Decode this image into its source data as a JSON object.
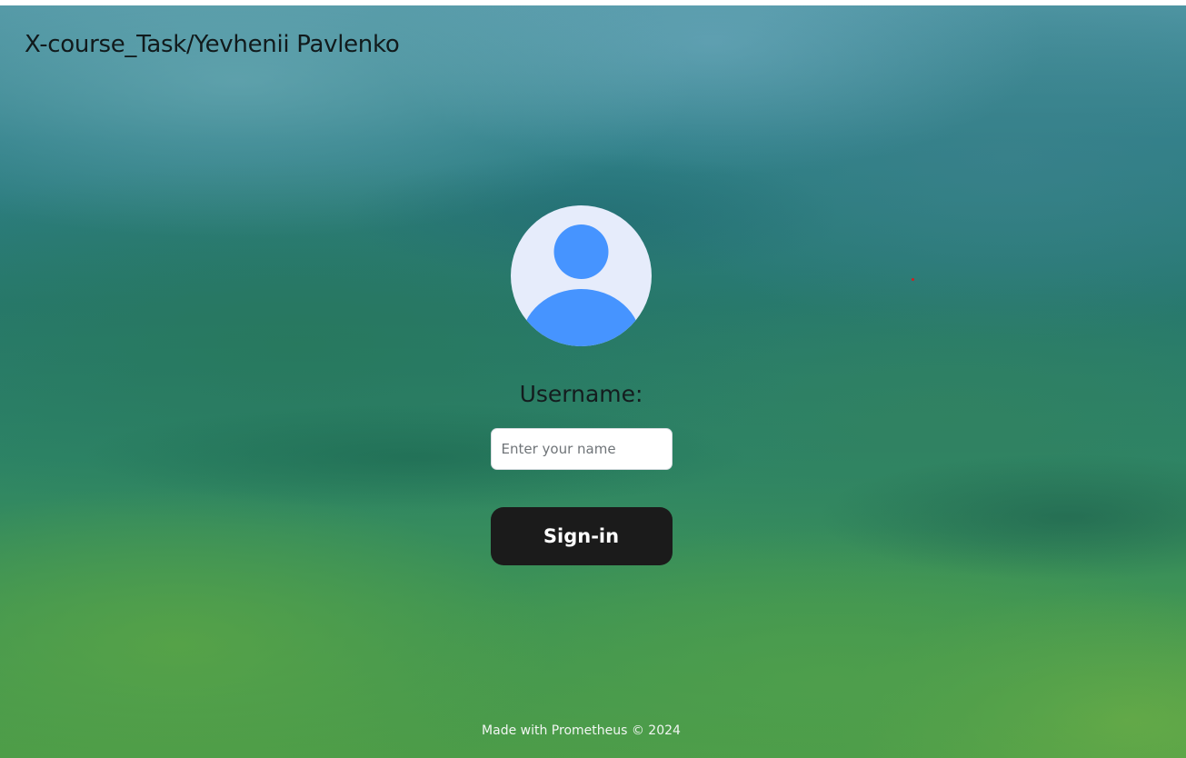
{
  "header": {
    "title": "X-course_Task/Yevhenii Pavlenko"
  },
  "login": {
    "avatar_icon": "user-avatar-icon",
    "username_label": "Username:",
    "username_input": {
      "value": "",
      "placeholder": "Enter your name"
    },
    "signin_label": "Sign-in"
  },
  "footer": {
    "text": "Made with Prometheus © 2024"
  },
  "colors": {
    "avatar_accent": "#4694ff",
    "avatar_background": "#e6ecfb",
    "button_background": "#1b1b1b",
    "button_text": "#ffffff"
  }
}
